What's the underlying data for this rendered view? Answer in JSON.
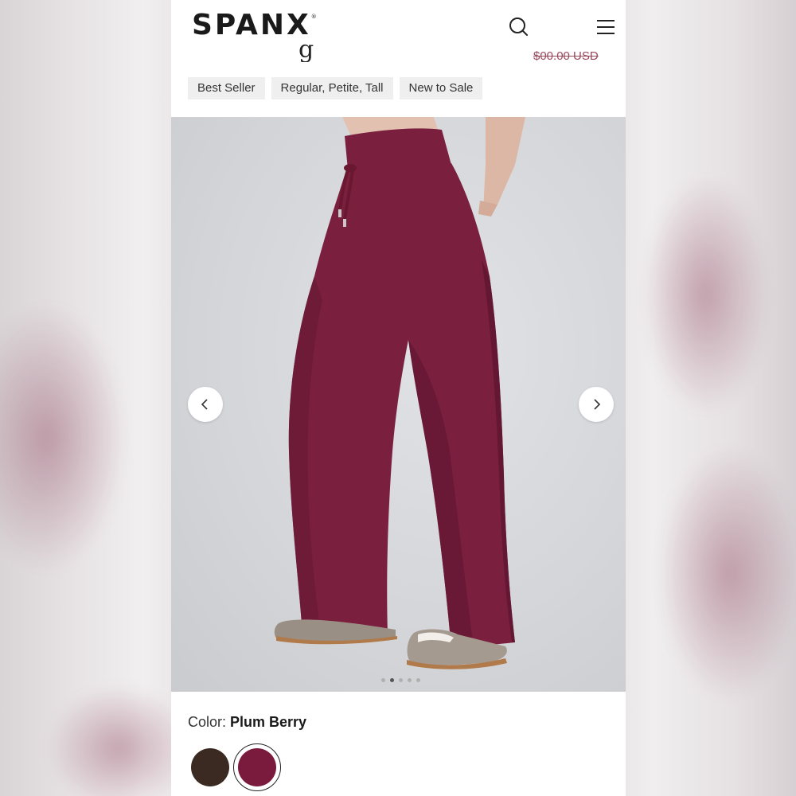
{
  "header": {
    "brand": "SPANX",
    "brand_mark": "®",
    "search_icon": "search-icon",
    "menu_icon": "hamburger-menu-icon"
  },
  "product": {
    "title_peek": "g",
    "price_peek": "$00.00 USD",
    "tags": [
      "Best Seller",
      "Regular, Petite, Tall",
      "New to Sale"
    ]
  },
  "gallery": {
    "prev_icon": "chevron-left-icon",
    "next_icon": "chevron-right-icon",
    "slides": 5,
    "active_slide": 2
  },
  "color": {
    "label": "Color:",
    "selected_name": "Plum Berry",
    "swatches": [
      {
        "name": "brown-swatch",
        "hex": "#3a2a22"
      },
      {
        "name": "plum-berry-swatch",
        "hex": "#7a1a3c"
      }
    ]
  },
  "colors": {
    "pant": "#7b1f3e",
    "pant_shadow": "#5e1530"
  }
}
